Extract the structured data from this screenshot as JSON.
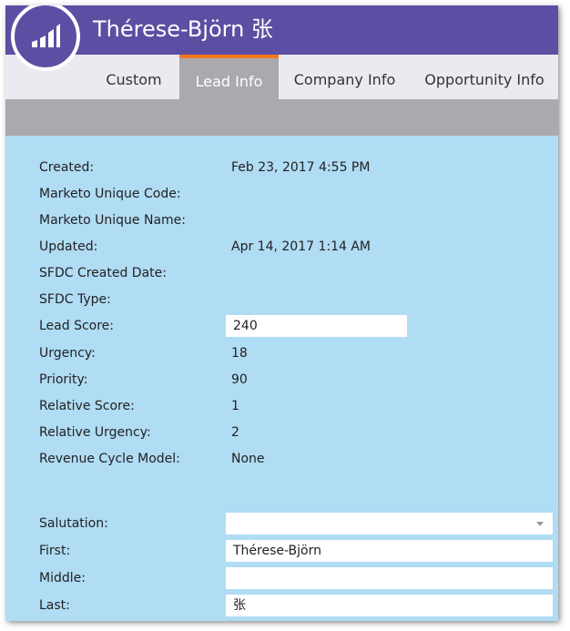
{
  "header": {
    "title": "Thérese-Björn 张"
  },
  "tabs": [
    {
      "label": "Custom",
      "active": false
    },
    {
      "label": "Lead Info",
      "active": true
    },
    {
      "label": "Company Info",
      "active": false
    },
    {
      "label": "Opportunity Info",
      "active": false
    }
  ],
  "colors": {
    "header": "#5b4fa3",
    "active_tab_accent": "#f3771f",
    "panel_background": "#b0dcf4"
  },
  "lead_info": {
    "created": {
      "label": "Created:",
      "value": "Feb 23, 2017 4:55 PM"
    },
    "marketo_unique_code": {
      "label": "Marketo Unique Code:",
      "value": ""
    },
    "marketo_unique_name": {
      "label": "Marketo Unique Name:",
      "value": ""
    },
    "updated": {
      "label": "Updated:",
      "value": "Apr 14, 2017 1:14 AM"
    },
    "sfdc_created_date": {
      "label": "SFDC Created Date:",
      "value": ""
    },
    "sfdc_type": {
      "label": "SFDC Type:",
      "value": ""
    },
    "lead_score": {
      "label": "Lead Score:",
      "value": "240"
    },
    "urgency": {
      "label": "Urgency:",
      "value": "18"
    },
    "priority": {
      "label": "Priority:",
      "value": "90"
    },
    "relative_score": {
      "label": "Relative Score:",
      "value": "1"
    },
    "relative_urgency": {
      "label": "Relative Urgency:",
      "value": "2"
    },
    "revenue_cycle_model": {
      "label": "Revenue Cycle Model:",
      "value": "None"
    }
  },
  "name_fields": {
    "salutation": {
      "label": "Salutation:",
      "value": ""
    },
    "first": {
      "label": "First:",
      "value": "Thérese-Björn"
    },
    "middle": {
      "label": "Middle:",
      "value": ""
    },
    "last": {
      "label": "Last:",
      "value": "张"
    }
  }
}
